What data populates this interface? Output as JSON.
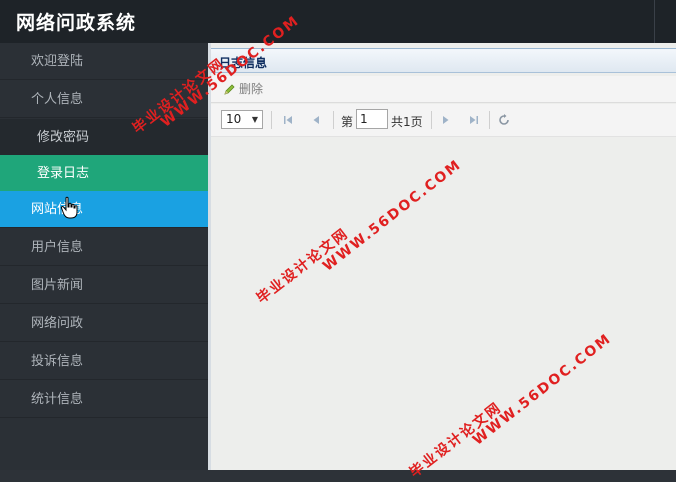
{
  "app": {
    "title": "网络问政系统"
  },
  "sidebar": {
    "items": [
      {
        "label": "欢迎登陆"
      },
      {
        "label": "个人信息"
      },
      {
        "label": "修改密码"
      },
      {
        "label": "登录日志"
      },
      {
        "label": "网站信息"
      },
      {
        "label": "用户信息"
      },
      {
        "label": "图片新闻"
      },
      {
        "label": "网络问政"
      },
      {
        "label": "投诉信息"
      },
      {
        "label": "统计信息"
      }
    ]
  },
  "panel": {
    "title": "日志信息"
  },
  "toolbar": {
    "delete_label": "删除"
  },
  "pager": {
    "page_size": "10",
    "page_prefix": "第",
    "page_value": "1",
    "page_total": "共1页"
  },
  "watermark": {
    "site": "WWW.56DOC.COM",
    "cn": "毕业设计论文网",
    "color": "#e02020"
  },
  "colors": {
    "active_green": "#1fa67a",
    "active_blue": "#1aa1e2",
    "sidebar_bg": "#2b3036"
  }
}
